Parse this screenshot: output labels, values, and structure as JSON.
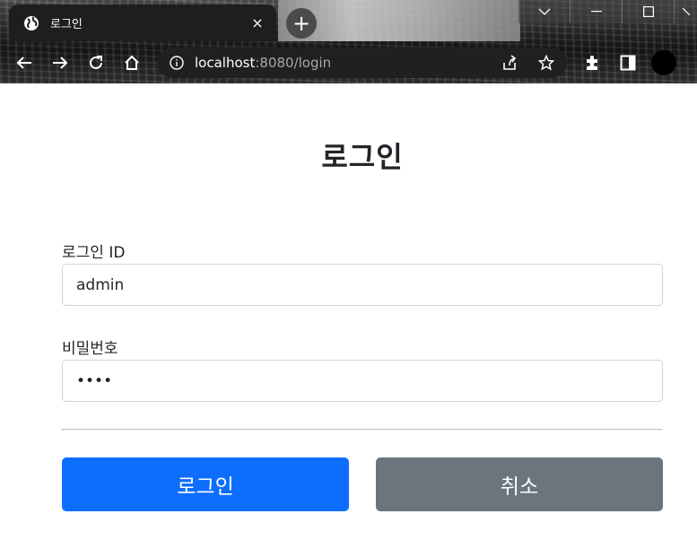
{
  "browser": {
    "tab": {
      "title": "로그인",
      "close_glyph": "×",
      "icon": "globe-icon"
    },
    "new_tab_glyph": "+",
    "window_controls": [
      "chevron-down-icon",
      "minimize-icon",
      "maximize-icon",
      "close-icon"
    ],
    "address_bar": {
      "host": "localhost",
      "path": ":8080/login"
    },
    "toolbar_icons": [
      "back-arrow-icon",
      "forward-arrow-icon",
      "reload-icon",
      "home-icon",
      "info-icon",
      "share-icon",
      "star-icon",
      "extensions-icon",
      "side-panel-icon",
      "avatar"
    ]
  },
  "page": {
    "title": "로그인",
    "form": {
      "login_id": {
        "label": "로그인 ID",
        "value": "admin"
      },
      "password": {
        "label": "비밀번호",
        "value": "abcd"
      }
    },
    "buttons": {
      "submit": "로그인",
      "cancel": "취소"
    }
  },
  "colors": {
    "primary": "#0d6efd",
    "secondary": "#6c757d",
    "text": "#212529",
    "input_border": "#ced4da"
  }
}
